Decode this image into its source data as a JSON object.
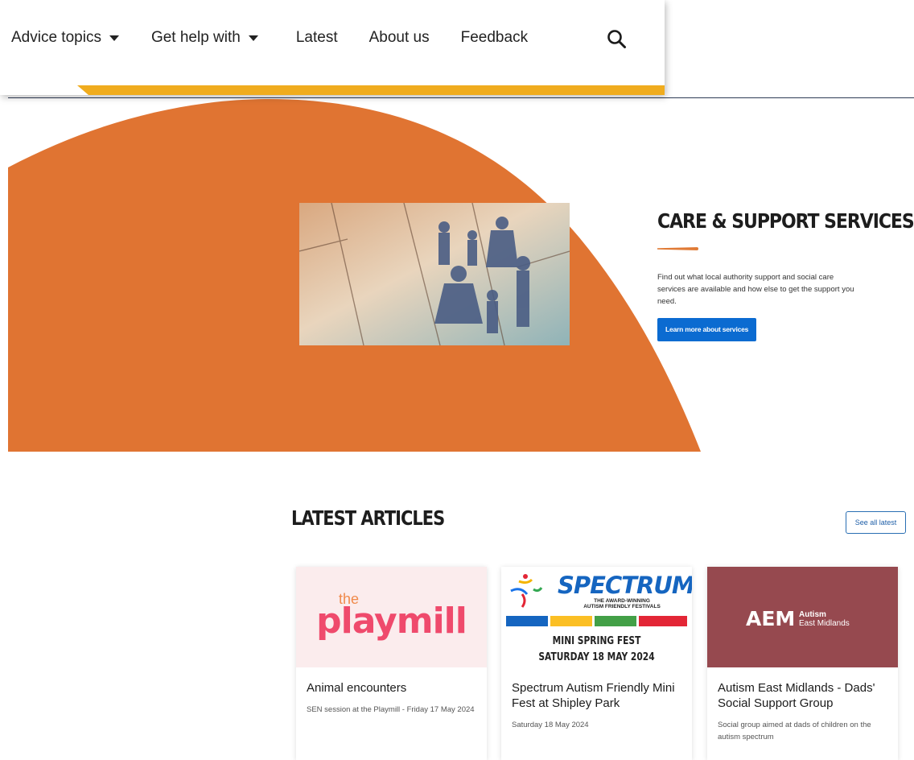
{
  "nav": {
    "items": [
      {
        "label": "Advice topics",
        "dropdown": true
      },
      {
        "label": "Get help with",
        "dropdown": true
      },
      {
        "label": "Latest",
        "dropdown": false
      },
      {
        "label": "About us",
        "dropdown": false
      },
      {
        "label": "Feedback",
        "dropdown": false
      }
    ],
    "search_icon": "search-icon",
    "accent_color": "#f0ac1e"
  },
  "hero": {
    "title": "CARE & SUPPORT SERVICES",
    "description": "Find out what local authority support and social care services are available and how else to get the support you need.",
    "button_label": "Learn more about services",
    "shape_color": "#e07432",
    "button_color": "#0b6bd1"
  },
  "latest": {
    "title": "LATEST ARTICLES",
    "see_all_label": "See all latest",
    "cards": [
      {
        "logo": {
          "small": "the",
          "big": "playmill"
        },
        "title": "Animal encounters",
        "subtitle": "SEN session at the Playmill - Friday 17 May 2024"
      },
      {
        "logo": {
          "big": "SPECTRUM",
          "tagline_1": "THE AWARD-WINNING",
          "tagline_2": "AUTISM FRIENDLY FESTIVALS",
          "line_1": "MINI SPRING FEST",
          "line_2": "SATURDAY 18 MAY 2024"
        },
        "title": "Spectrum Autism Friendly Mini Fest at Shipley Park",
        "subtitle": "Saturday 18 May 2024"
      },
      {
        "logo": {
          "big": "AEM",
          "line_1": "Autism",
          "line_2": "East Midlands"
        },
        "title": "Autism East Midlands - Dads' Social Support Group",
        "subtitle": "Social group aimed at dads of children on the autism spectrum"
      }
    ]
  }
}
